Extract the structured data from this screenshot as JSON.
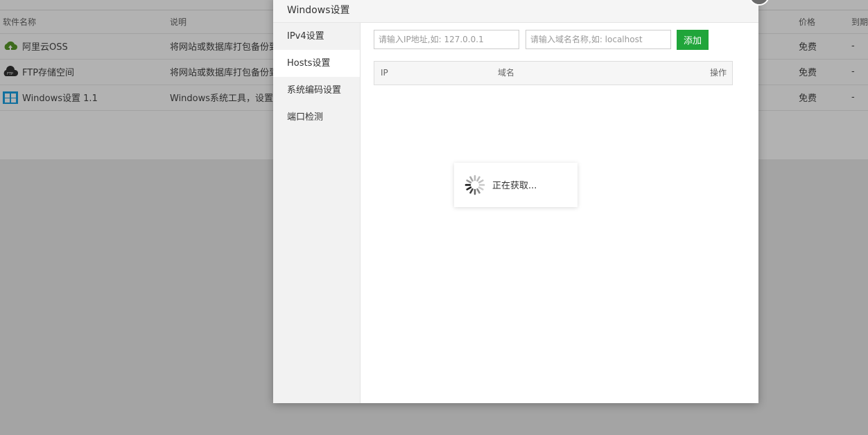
{
  "background": {
    "table": {
      "headers": {
        "name": "软件名称",
        "desc": "说明",
        "price": "价格",
        "expire": "到期"
      },
      "rows": [
        {
          "name": "阿里云OSS",
          "desc": "将网站或数据库打包备份到阿",
          "price": "免费",
          "expire": "-",
          "icon": "cloud-upload-icon"
        },
        {
          "name": "FTP存储空间",
          "desc": "将网站或数据库打包备份到F",
          "price": "免费",
          "expire": "-",
          "icon": "ftp-cloud-icon"
        },
        {
          "name": "Windows设置 1.1",
          "desc": "Windows系统工具，设置dr",
          "price": "免费",
          "expire": "-",
          "icon": "windows-logo-icon"
        }
      ]
    }
  },
  "dialog": {
    "title": "Windows设置",
    "nav": [
      {
        "label": "IPv4设置",
        "active": false
      },
      {
        "label": "Hosts设置",
        "active": true
      },
      {
        "label": "系统编码设置",
        "active": false
      },
      {
        "label": "端口检测",
        "active": false
      }
    ],
    "ip_input": {
      "value": "",
      "placeholder": "请输入IP地址,如: 127.0.0.1"
    },
    "domain_input": {
      "value": "",
      "placeholder": "请输入域名名称,如: localhost"
    },
    "add_button": "添加",
    "table_headers": {
      "ip": "IP",
      "domain": "域名",
      "op": "操作"
    }
  },
  "loading": {
    "text": "正在获取..."
  },
  "colors": {
    "accent_green": "#20a53a",
    "overlay": "rgba(0,0,0,0.3)"
  }
}
